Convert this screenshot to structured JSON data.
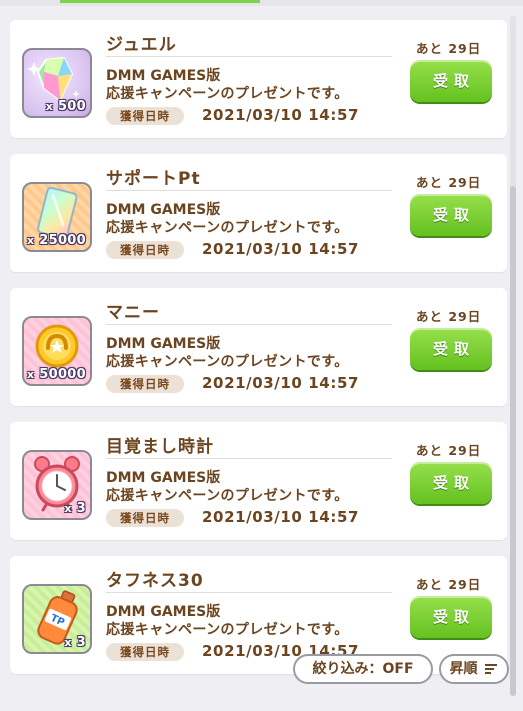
{
  "colors": {
    "button_green": "#7bd34a",
    "text_brown": "#6b4420",
    "tag_bg": "#ece1d7"
  },
  "items": [
    {
      "name": "ジュエル",
      "icon": "jewel-icon",
      "qty": "500",
      "desc_line1": "DMM GAMES版",
      "desc_line2": "応援キャンペーンのプレゼントです。",
      "tag": "獲得日時",
      "date": "2021/03/10 14:57",
      "remaining": "あと 29日",
      "button": "受取"
    },
    {
      "name": "サポートPt",
      "icon": "support-pt-card-icon",
      "qty": "25000",
      "desc_line1": "DMM GAMES版",
      "desc_line2": "応援キャンペーンのプレゼントです。",
      "tag": "獲得日時",
      "date": "2021/03/10 14:57",
      "remaining": "あと 29日",
      "button": "受取"
    },
    {
      "name": "マニー",
      "icon": "money-coin-icon",
      "qty": "50000",
      "desc_line1": "DMM GAMES版",
      "desc_line2": "応援キャンペーンのプレゼントです。",
      "tag": "獲得日時",
      "date": "2021/03/10 14:57",
      "remaining": "あと 29日",
      "button": "受取"
    },
    {
      "name": "目覚まし時計",
      "icon": "alarm-clock-icon",
      "qty": "3",
      "desc_line1": "DMM GAMES版",
      "desc_line2": "応援キャンペーンのプレゼントです。",
      "tag": "獲得日時",
      "date": "2021/03/10 14:57",
      "remaining": "あと 29日",
      "button": "受取"
    },
    {
      "name": "タフネス30",
      "icon": "tp-bottle-icon",
      "qty": "3",
      "desc_line1": "DMM GAMES版",
      "desc_line2": "応援キャンペーンのプレゼントです。",
      "tag": "獲得日時",
      "date": "2021/03/10 14:57",
      "remaining": "あと 29日",
      "button": "受取"
    }
  ],
  "icon_x_prefix": "x",
  "footer": {
    "filter_label": "絞り込み：OFF",
    "sort_label": "昇順"
  }
}
